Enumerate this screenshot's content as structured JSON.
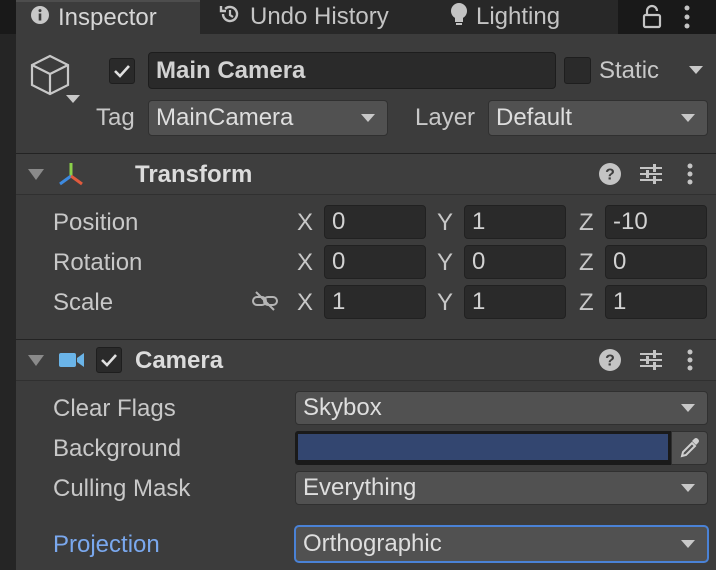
{
  "tabs": [
    {
      "label": "Inspector",
      "icon": "info-icon"
    },
    {
      "label": "Undo History",
      "icon": "history-icon"
    },
    {
      "label": "Lighting",
      "icon": "lightbulb-icon"
    }
  ],
  "game_object": {
    "enabled": true,
    "name": "Main Camera",
    "static_label": "Static",
    "static_checked": false,
    "tag_label": "Tag",
    "tag_value": "MainCamera",
    "layer_label": "Layer",
    "layer_value": "Default"
  },
  "transform": {
    "title": "Transform",
    "rows": [
      {
        "label": "Position",
        "x": "0",
        "y": "1",
        "z": "-10"
      },
      {
        "label": "Rotation",
        "x": "0",
        "y": "0",
        "z": "0"
      },
      {
        "label": "Scale",
        "x": "1",
        "y": "1",
        "z": "1"
      }
    ],
    "axes": {
      "x": "X",
      "y": "Y",
      "z": "Z"
    }
  },
  "camera": {
    "title": "Camera",
    "enabled": true,
    "clear_flags_label": "Clear Flags",
    "clear_flags_value": "Skybox",
    "background_label": "Background",
    "background_color": "#334670",
    "culling_mask_label": "Culling Mask",
    "culling_mask_value": "Everything",
    "projection_label": "Projection",
    "projection_value": "Orthographic"
  },
  "colors": {
    "accent_blue": "#7aa8ee",
    "focus_border": "#4a82d6"
  }
}
